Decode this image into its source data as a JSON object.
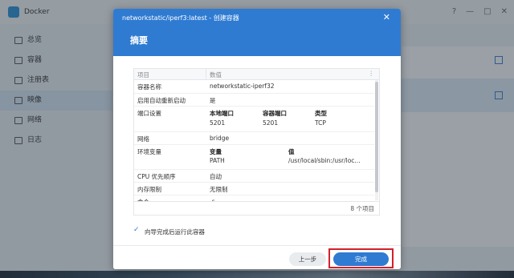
{
  "app": {
    "title": "Docker",
    "sidebar": [
      {
        "label": "总览",
        "icon": "overview-icon"
      },
      {
        "label": "容器",
        "icon": "container-icon"
      },
      {
        "label": "注册表",
        "icon": "registry-icon"
      },
      {
        "label": "映像",
        "icon": "image-icon",
        "active": true
      },
      {
        "label": "网络",
        "icon": "network-icon"
      },
      {
        "label": "日志",
        "icon": "log-icon"
      }
    ],
    "window_controls": [
      "?",
      "—",
      "□",
      "✕"
    ]
  },
  "dialog": {
    "title": "networkstatic/iperf3:latest - 创建容器",
    "close": "✕",
    "heading": "摘要",
    "table": {
      "headers": {
        "key": "项目",
        "value": "数值",
        "more": "⋮"
      },
      "rows": {
        "name": {
          "key": "容器名称",
          "value": "networkstatic-iperf32"
        },
        "autostart": {
          "key": "启用自动重新启动",
          "value": "是"
        },
        "ports": {
          "key": "端口设置",
          "headers": [
            "本地端口",
            "容器端口",
            "类型"
          ],
          "values": [
            "5201",
            "5201",
            "TCP"
          ]
        },
        "network": {
          "key": "网络",
          "value": "bridge"
        },
        "env": {
          "key": "环境变量",
          "headers": [
            "变量",
            "值"
          ],
          "values": [
            "PATH",
            "/usr/local/sbin:/usr/loc..."
          ]
        },
        "cpu": {
          "key": "CPU 优先顺序",
          "value": "自动"
        },
        "memory": {
          "key": "内存限制",
          "value": "无限制"
        },
        "command": {
          "key": "命令",
          "value": "-s"
        }
      },
      "count": "8 个项目"
    },
    "checkbox": {
      "label": "向导完成后运行此容器",
      "checked": true
    },
    "buttons": {
      "prev": "上一步",
      "finish": "完成"
    }
  }
}
